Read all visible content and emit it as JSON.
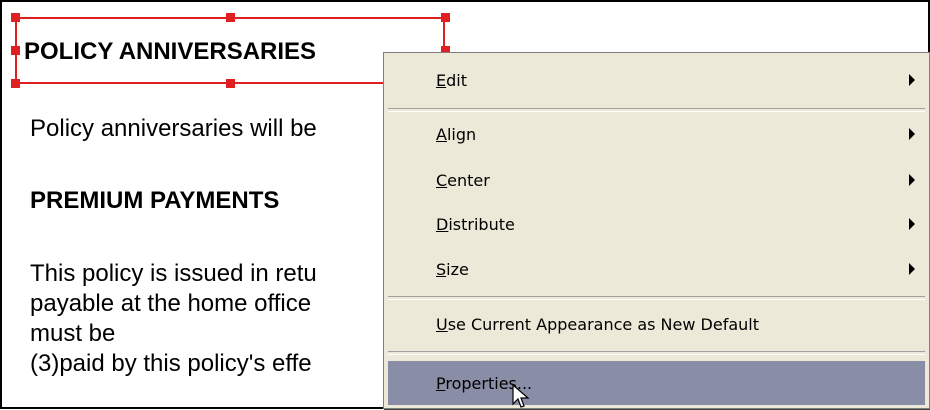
{
  "document": {
    "heading1": "POLICY ANNIVERSARIES",
    "para1": "Policy anniversaries will be",
    "heading2": "PREMIUM PAYMENTS",
    "para2_line1": "This policy is issued in retu",
    "para2_line2": "payable at the home office",
    "para2_line3": "must be",
    "para2_line4": "(3)paid by this policy's effe"
  },
  "context_menu": {
    "items": [
      {
        "label": "Edit",
        "mnemonic": "E",
        "submenu": true
      },
      {
        "label": "Align",
        "mnemonic": "A",
        "submenu": true
      },
      {
        "label": "Center",
        "mnemonic": "C",
        "submenu": true
      },
      {
        "label": "Distribute",
        "mnemonic": "D",
        "submenu": true
      },
      {
        "label": "Size",
        "mnemonic": "S",
        "submenu": true
      },
      {
        "label": "Use Current Appearance as New Default",
        "mnemonic": "U",
        "submenu": false
      },
      {
        "label": "Properties...",
        "mnemonic": "P",
        "submenu": false,
        "highlighted": true
      }
    ]
  },
  "colors": {
    "selection": "#e02020",
    "menu_bg": "#ece9d8",
    "highlight": "#8a8da6"
  }
}
